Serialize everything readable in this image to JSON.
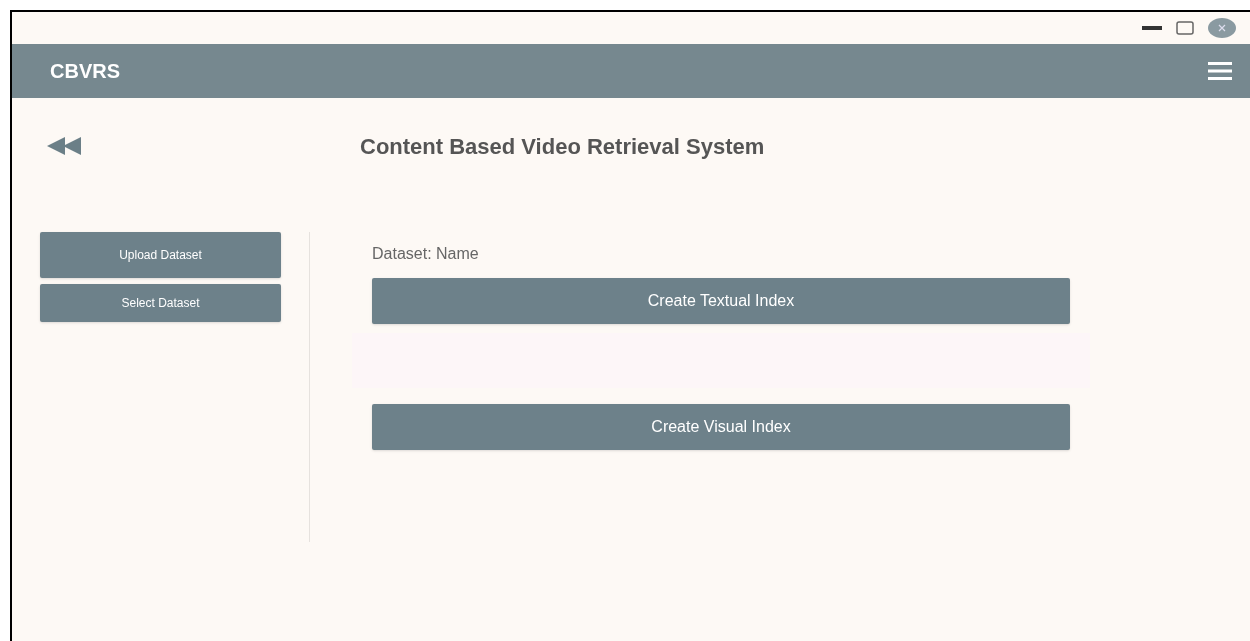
{
  "app_bar": {
    "title": "CBVRS"
  },
  "page_title": "Content Based Video Retrieval System",
  "sidebar": {
    "buttons": [
      "Upload Dataset",
      "Select Dataset"
    ]
  },
  "main": {
    "dataset_label": "Dataset: Name",
    "buttons": [
      "Create Textual Index",
      "Create Visual Index"
    ]
  }
}
